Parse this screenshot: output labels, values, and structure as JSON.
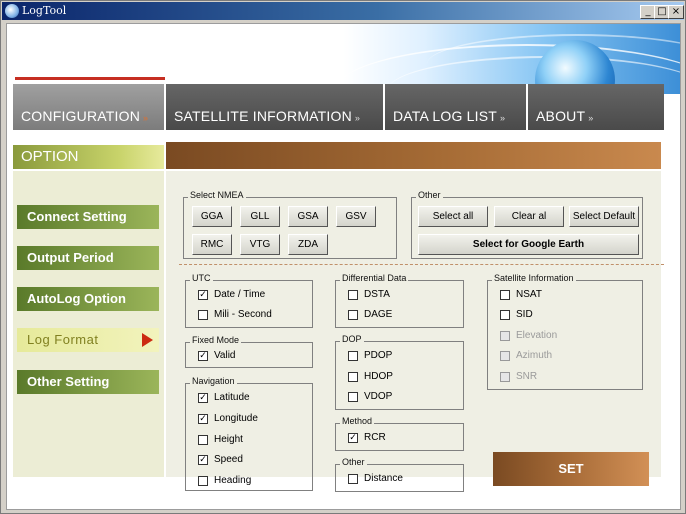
{
  "window": {
    "title": "LogTool",
    "minimize": "_",
    "maximize": "□",
    "close": "×"
  },
  "nav": {
    "tabs": [
      {
        "label": "CONFIGURATION",
        "active": true
      },
      {
        "label": "SATELLITE INFORMATION"
      },
      {
        "label": "DATA LOG LIST"
      },
      {
        "label": "ABOUT"
      }
    ],
    "arrow": "»"
  },
  "sidebar": {
    "header": "OPTION",
    "items": [
      {
        "label": "Connect Setting"
      },
      {
        "label": "Output Period"
      },
      {
        "label": "AutoLog Option"
      },
      {
        "label": "Log Format",
        "active": true
      },
      {
        "label": "Other Setting"
      }
    ]
  },
  "nmea": {
    "label": "Select NMEA",
    "buttons": [
      "GGA",
      "GLL",
      "GSA",
      "GSV",
      "RMC",
      "VTG",
      "ZDA"
    ]
  },
  "other_top": {
    "label": "Other",
    "select_all": "Select all",
    "clear_all": "Clear al",
    "select_default": "Select Default",
    "google_earth": "Select for Google Earth"
  },
  "utc": {
    "label": "UTC",
    "items": [
      {
        "label": "Date / Time",
        "checked": true
      },
      {
        "label": "Mili - Second",
        "checked": false
      }
    ]
  },
  "fixed_mode": {
    "label": "Fixed Mode",
    "items": [
      {
        "label": "Valid",
        "checked": true
      }
    ]
  },
  "navigation": {
    "label": "Navigation",
    "items": [
      {
        "label": "Latitude",
        "checked": true
      },
      {
        "label": "Longitude",
        "checked": true
      },
      {
        "label": "Height",
        "checked": false
      },
      {
        "label": "Speed",
        "checked": true
      },
      {
        "label": "Heading",
        "checked": false
      }
    ]
  },
  "differential": {
    "label": "Differential Data",
    "items": [
      {
        "label": "DSTA",
        "checked": false
      },
      {
        "label": "DAGE",
        "checked": false
      }
    ]
  },
  "dop": {
    "label": "DOP",
    "items": [
      {
        "label": "PDOP",
        "checked": false
      },
      {
        "label": "HDOP",
        "checked": false
      },
      {
        "label": "VDOP",
        "checked": false
      }
    ]
  },
  "method": {
    "label": "Method",
    "items": [
      {
        "label": "RCR",
        "checked": true
      }
    ]
  },
  "other_bottom": {
    "label": "Other",
    "items": [
      {
        "label": "Distance",
        "checked": false
      }
    ]
  },
  "satellite_info": {
    "label": "Satellite Information",
    "items": [
      {
        "label": "NSAT",
        "checked": false,
        "disabled": false
      },
      {
        "label": "SID",
        "checked": false,
        "disabled": false
      },
      {
        "label": "Elevation",
        "checked": false,
        "disabled": true
      },
      {
        "label": "Azimuth",
        "checked": false,
        "disabled": true
      },
      {
        "label": "SNR",
        "checked": false,
        "disabled": true
      }
    ]
  },
  "set_button": "SET",
  "check_mark": "✓"
}
